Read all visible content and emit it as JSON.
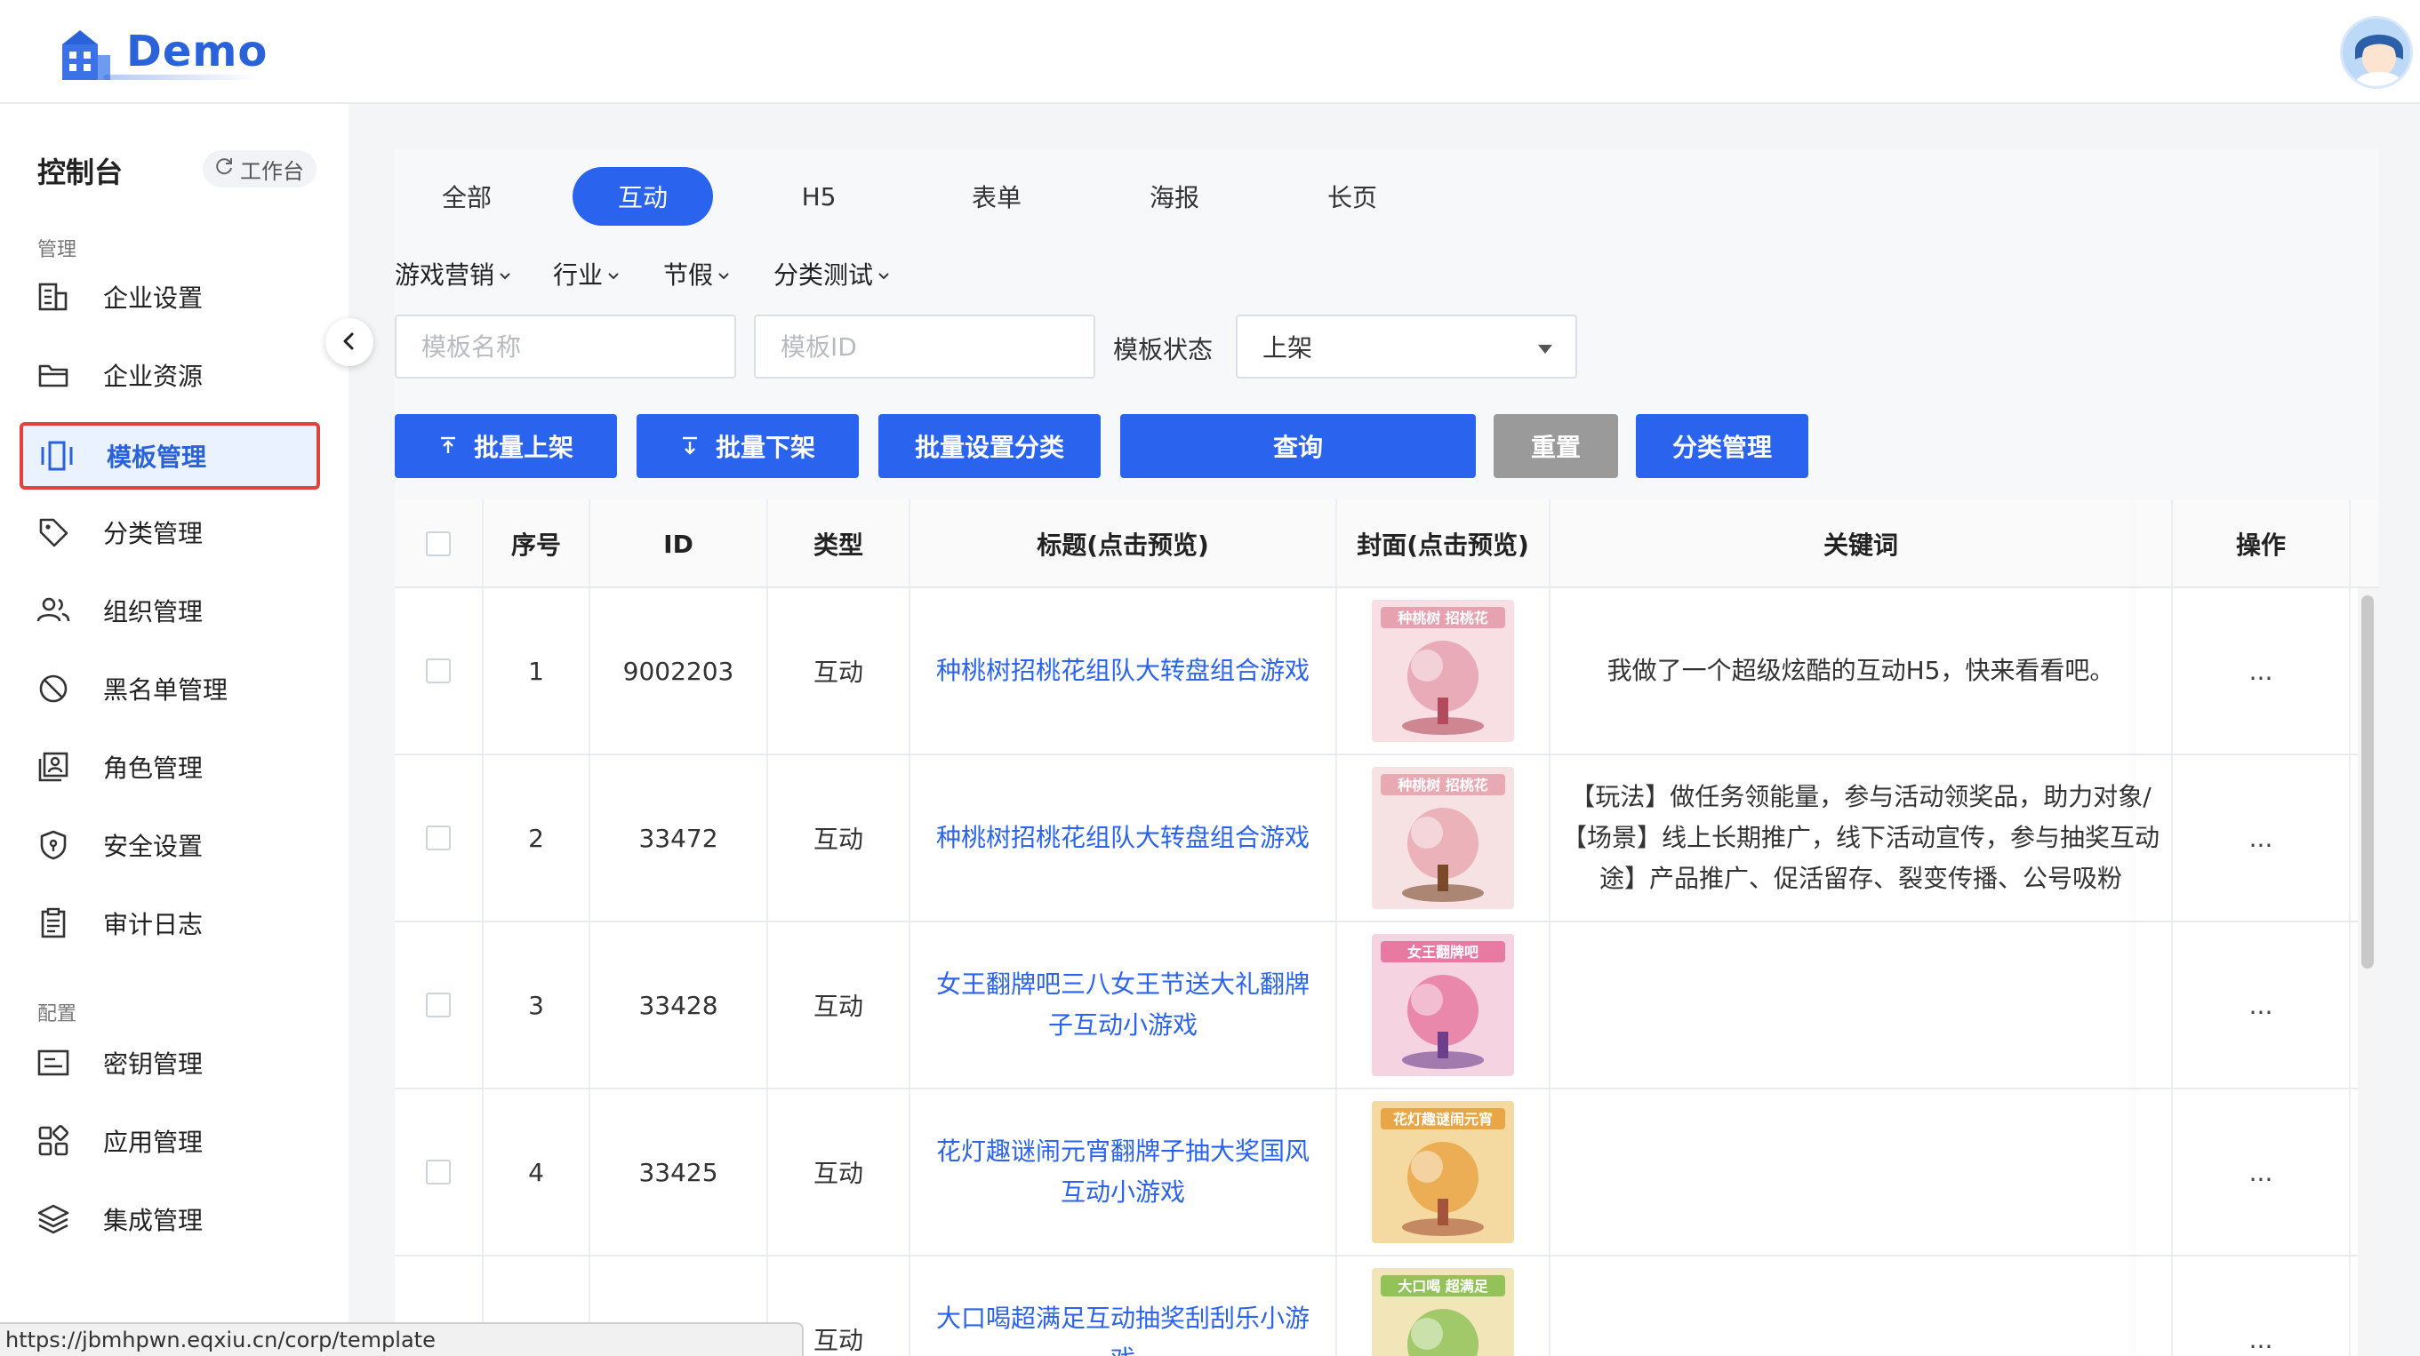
{
  "app": {
    "logo_text": "Demo"
  },
  "sidebar": {
    "title": "控制台",
    "workbench_label": "工作台",
    "section_manage": "管理",
    "section_config": "配置",
    "items": [
      {
        "label": "企业设置",
        "icon": "building-icon"
      },
      {
        "label": "企业资源",
        "icon": "folder-icon"
      },
      {
        "label": "模板管理",
        "icon": "template-icon",
        "active": true
      },
      {
        "label": "分类管理",
        "icon": "tag-icon"
      },
      {
        "label": "组织管理",
        "icon": "users-icon"
      },
      {
        "label": "黑名单管理",
        "icon": "ban-icon"
      },
      {
        "label": "角色管理",
        "icon": "role-icon"
      },
      {
        "label": "安全设置",
        "icon": "shield-icon"
      },
      {
        "label": "审计日志",
        "icon": "clipboard-icon"
      },
      {
        "label": "密钥管理",
        "icon": "key-card-icon"
      },
      {
        "label": "应用管理",
        "icon": "apps-grid-icon"
      },
      {
        "label": "集成管理",
        "icon": "layers-icon"
      }
    ]
  },
  "tabs": [
    {
      "label": "全部"
    },
    {
      "label": "互动",
      "active": true
    },
    {
      "label": "H5"
    },
    {
      "label": "表单"
    },
    {
      "label": "海报"
    },
    {
      "label": "长页"
    }
  ],
  "subcategories": [
    {
      "label": "游戏营销"
    },
    {
      "label": "行业"
    },
    {
      "label": "节假"
    },
    {
      "label": "分类测试"
    }
  ],
  "filters": {
    "name_placeholder": "模板名称",
    "id_placeholder": "模板ID",
    "status_label": "模板状态",
    "status_value": "上架"
  },
  "actions": {
    "batch_on": "批量上架",
    "batch_off": "批量下架",
    "batch_category": "批量设置分类",
    "query": "查询",
    "reset": "重置",
    "category_manage": "分类管理"
  },
  "table": {
    "headers": {
      "index": "序号",
      "id": "ID",
      "type": "类型",
      "title": "标题(点击预览)",
      "cover": "封面(点击预览)",
      "keywords": "关键词",
      "ops": "操作"
    },
    "rows": [
      {
        "index": "1",
        "id": "9002203",
        "type": "互动",
        "title_lines": [
          "种桃树招桃花组队大转盘组合游戏",
          ""
        ],
        "keyword_lines": [
          "我做了一个超级炫酷的互动H5，快来看看吧。",
          "",
          ""
        ],
        "ops": "...",
        "cover_caption": "种桃树 招桃花"
      },
      {
        "index": "2",
        "id": "33472",
        "type": "互动",
        "title_lines": [
          "种桃树招桃花组队大转盘组合游戏",
          ""
        ],
        "keyword_lines": [
          "【玩法】做任务领能量，参与活动领奖品，助力对象/",
          "【场景】线上长期推广，线下活动宣传，参与抽奖互动",
          "途】产品推广、促活留存、裂变传播、公号吸粉"
        ],
        "ops": "...",
        "cover_caption": "种桃树 招桃花"
      },
      {
        "index": "3",
        "id": "33428",
        "type": "互动",
        "title_lines": [
          "女王翻牌吧三八女王节送大礼翻牌",
          "子互动小游戏"
        ],
        "keyword_lines": [
          "",
          "",
          ""
        ],
        "ops": "...",
        "cover_caption": "女王翻牌吧"
      },
      {
        "index": "4",
        "id": "33425",
        "type": "互动",
        "title_lines": [
          "花灯趣谜闹元宵翻牌子抽大奖国风",
          "互动小游戏"
        ],
        "keyword_lines": [
          "",
          "",
          ""
        ],
        "ops": "...",
        "cover_caption": "花灯趣谜闹元宵"
      },
      {
        "index": "",
        "id": "",
        "type": "互动",
        "title_lines": [
          "大口喝超满足互动抽奖刮刮乐小游",
          "戏"
        ],
        "keyword_lines": [
          "",
          "",
          ""
        ],
        "ops": "...",
        "cover_caption": "大口喝 超满足"
      }
    ]
  },
  "status_bar": {
    "url": "https://jbmhpwn.eqxiu.cn/corp/template"
  },
  "colors": {
    "primary": "#2a63ed",
    "active_border": "#e0433a",
    "reset_gray": "#9a9a9a"
  }
}
